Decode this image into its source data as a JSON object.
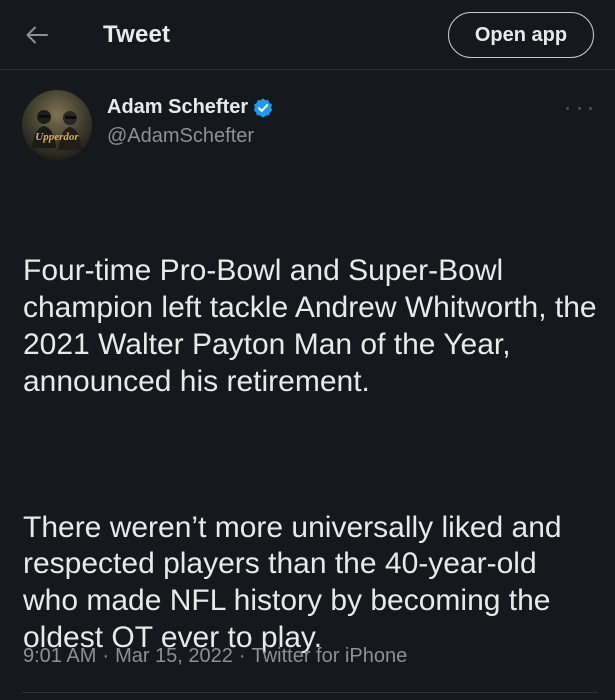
{
  "header": {
    "title": "Tweet",
    "open_app_label": "Open app",
    "back_icon": "arrow-left-icon"
  },
  "author": {
    "display_name": "Adam Schefter",
    "handle": "@AdamSchefter",
    "verified_icon": "verified-badge-icon",
    "avatar_text": "Upperdor"
  },
  "tweet": {
    "paragraphs": [
      "Four-time Pro-Bowl and Super-Bowl champion left tackle Andrew Whitworth, the 2021 Walter Payton Man of the Year, announced his retirement.",
      "There weren’t more universally liked and respected players than the 40-year-old who made NFL history by becoming the oldest OT ever to play."
    ]
  },
  "meta": {
    "time": "9:01 AM",
    "date": "Mar 15, 2022",
    "source": "Twitter for iPhone",
    "separator": "·"
  },
  "colors": {
    "background": "#15181c",
    "text": "#e7e9ea",
    "secondary_text": "#8b9197",
    "verified_blue": "#1d9bf0"
  }
}
